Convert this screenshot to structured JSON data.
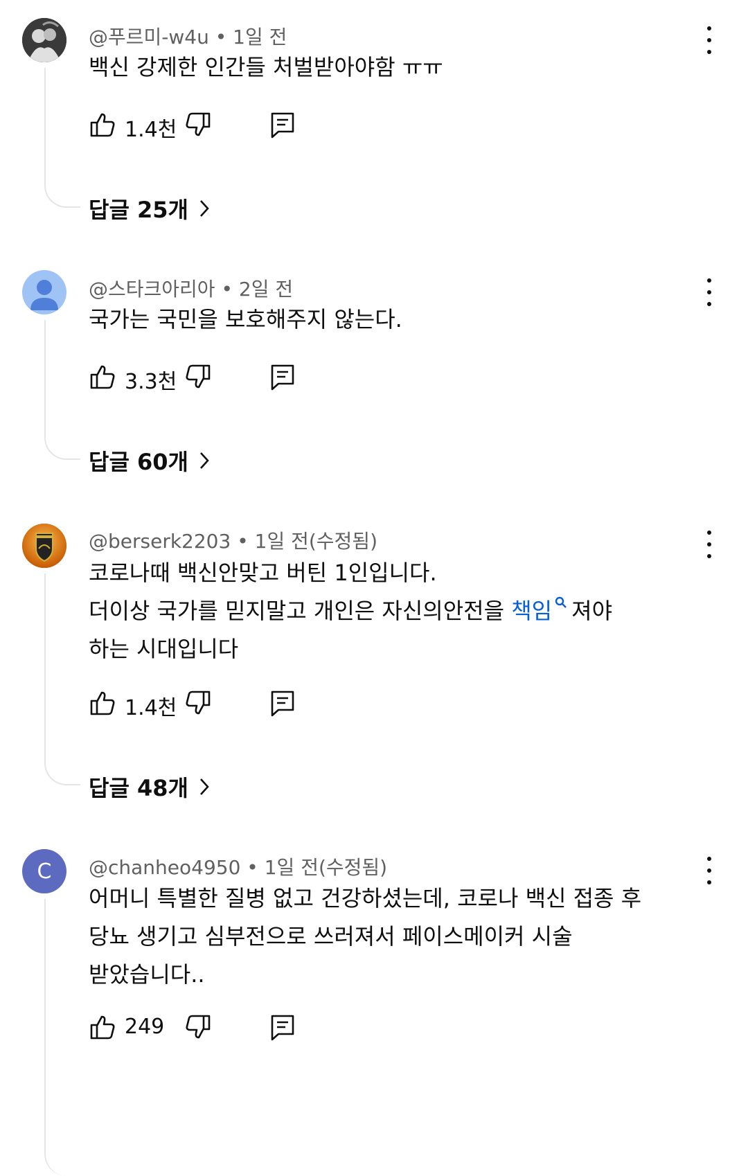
{
  "comments": [
    {
      "author": "@푸르미-w4u",
      "time": " • 1일 전",
      "lines": [
        "백신 강제한 인간들 처벌받아야함 ㅠㅠ"
      ],
      "likes": "1.4천",
      "replies": "답글 25개"
    },
    {
      "author": "@스타크아리아",
      "time": " • 2일 전",
      "lines": [
        "국가는 국민을 보호해주지 않는다."
      ],
      "likes": "3.3천",
      "replies": "답글 60개"
    },
    {
      "author": "@berserk2203",
      "time": " • 1일 전(수정됨)",
      "line1": "코로나때 백신안맞고 버틴 1인입니다.",
      "line2_pre": "더이상 국가를 믿지말고 개인은 자신의안전을 ",
      "line2_link": "책임",
      "line2_post": "져야",
      "line3": "하는 시대입니다",
      "likes": "1.4천",
      "replies": "답글 48개"
    },
    {
      "author": "@chanheo4950",
      "time": " • 1일 전(수정됨)",
      "avatar_letter": "C",
      "lines": [
        "어머니 특별한 질병 없고 건강하셨는데, 코로나 백신 접종 후",
        "당뇨 생기고 심부전으로 쓰러져서 페이스메이커 시술",
        "받았습니다.."
      ],
      "likes": "249"
    }
  ],
  "colors": {
    "text": "#0f0f0f",
    "meta": "#606060",
    "link": "#065fd4",
    "thread_line": "#e5e5e5",
    "avatar_default": "#a0c3f5",
    "avatar_c": "#5c6bc0"
  },
  "icons": [
    "like-icon",
    "dislike-icon",
    "reply-icon",
    "more-icon",
    "chevron-right-icon",
    "search-icon"
  ]
}
